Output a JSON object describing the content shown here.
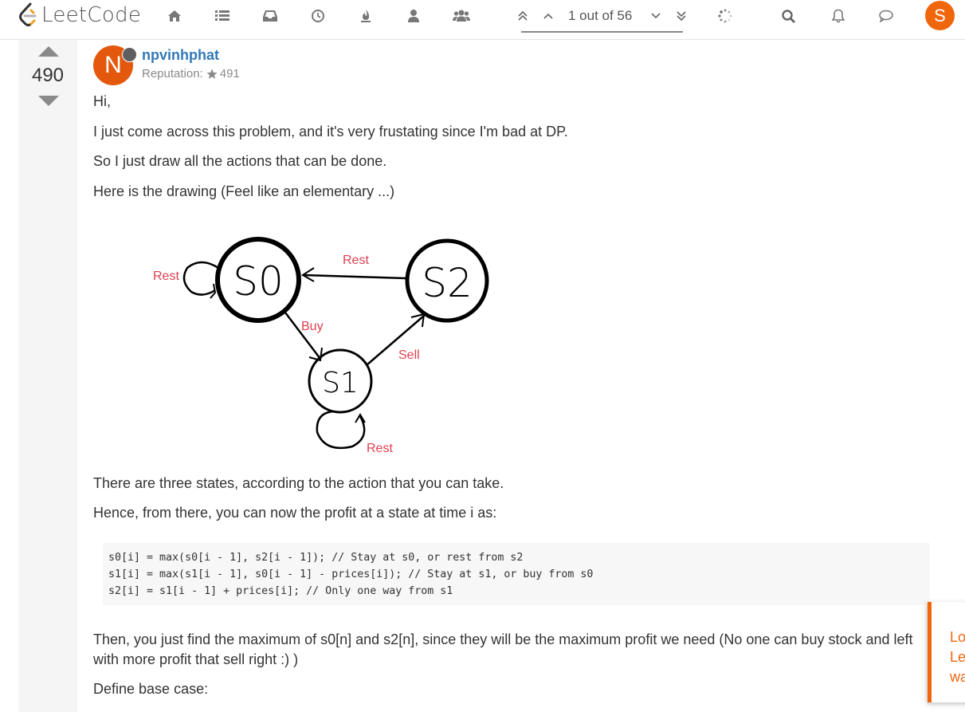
{
  "app": {
    "brand": "LeetCode",
    "accent_color": "#f0660c"
  },
  "nav": {
    "icons": [
      "home-icon",
      "list-icon",
      "inbox-icon",
      "clock-icon",
      "fire-icon",
      "user-icon",
      "users-icon"
    ],
    "pager_text": "1 out of 56",
    "user_initial": "S"
  },
  "post": {
    "votes": "490",
    "author_initial": "N",
    "author": "npvinhphat",
    "reputation_label": "Reputation:",
    "reputation_value": "491",
    "paragraphs": [
      "Hi,",
      "I just come across this problem, and it's very frustating since I'm bad at DP.",
      "So I just draw all the actions that can be done.",
      "Here is the drawing (Feel like an elementary ...)"
    ],
    "diagram": {
      "labels": {
        "s0": "S0",
        "s1": "S1",
        "s2": "S2",
        "rest_s0": "Rest",
        "rest_s2_s0": "Rest",
        "buy": "Buy",
        "sell": "Sell",
        "rest_s1": "Rest"
      }
    },
    "after_paragraphs": [
      "There are three states, according to the action that you can take.",
      "Hence, from there, you can now the profit at a state at time i as:"
    ],
    "code_lines": [
      "s0[i] = max(s0[i - 1], s2[i - 1]); // Stay at s0, or rest from s2",
      "s1[i] = max(s1[i - 1], s0[i - 1] - prices[i]); // Stay at s1, or buy from s0",
      "s2[i] = s1[i - 1] + prices[i]; // Only one way from s1"
    ],
    "conclusion": "Then, you just find the maximum of s0[n] and s2[n], since they will be the maximum profit we need (No one can buy stock and left with more profit that sell right :) )",
    "base_case": "Define base case:"
  },
  "toast": {
    "lines": [
      "Loc",
      "Lee",
      "wa"
    ]
  }
}
